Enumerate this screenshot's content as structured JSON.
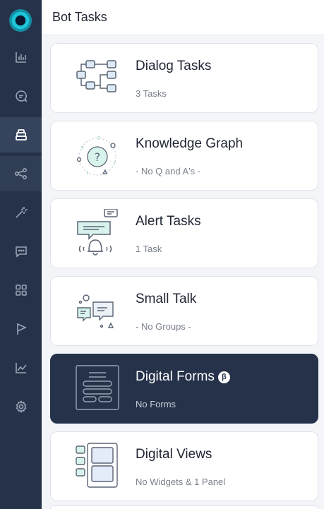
{
  "header": {
    "title": "Bot Tasks"
  },
  "sidebar": {
    "items": [
      {
        "icon": "bar-chart-icon"
      },
      {
        "icon": "chat-search-icon"
      },
      {
        "icon": "bot-tasks-icon",
        "active": true
      },
      {
        "icon": "share-nodes-icon"
      },
      {
        "icon": "magic-wand-icon"
      },
      {
        "icon": "chat-dots-icon"
      },
      {
        "icon": "grid-icon"
      },
      {
        "icon": "flag-icon"
      },
      {
        "icon": "line-chart-icon"
      },
      {
        "icon": "gear-icon"
      }
    ]
  },
  "cards": [
    {
      "title": "Dialog Tasks",
      "subtitle": "3 Tasks"
    },
    {
      "title": "Knowledge Graph",
      "subtitle": "- No Q and A's -"
    },
    {
      "title": "Alert Tasks",
      "subtitle": "1 Task"
    },
    {
      "title": "Small Talk",
      "subtitle": "- No Groups -"
    },
    {
      "title": "Digital Forms",
      "subtitle": "No Forms",
      "badge": "β",
      "selected": true
    },
    {
      "title": "Digital Views",
      "subtitle": "No Widgets & 1 Panel"
    }
  ],
  "colors": {
    "sidebar": "#25324a",
    "active": "#35435c",
    "accent": "#1ec5d8",
    "selected_card": "#25324a"
  }
}
